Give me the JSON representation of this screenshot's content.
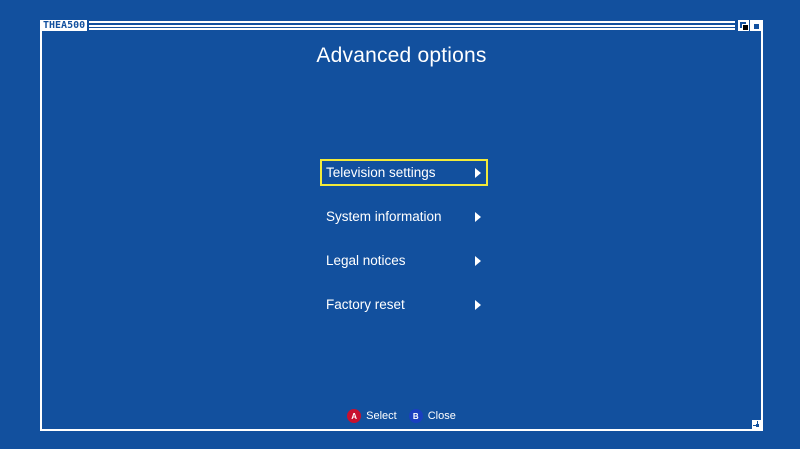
{
  "window": {
    "title": "THEA500"
  },
  "page": {
    "title": "Advanced options"
  },
  "menu": {
    "items": [
      {
        "label": "Television settings",
        "selected": true
      },
      {
        "label": "System information",
        "selected": false
      },
      {
        "label": "Legal notices",
        "selected": false
      },
      {
        "label": "Factory reset",
        "selected": false
      }
    ]
  },
  "footer": {
    "hints": [
      {
        "button": "A",
        "label": "Select",
        "color": "#c8102e"
      },
      {
        "button": "B",
        "label": "Close",
        "color": "#1a3fc0"
      }
    ]
  },
  "colors": {
    "background": "#12509e",
    "selection": "#f2ea3a",
    "text": "#ffffff"
  },
  "icons": {
    "arrow": "triangle-right-icon",
    "depth": "depth-gadget-icon",
    "zoom": "zoom-gadget-icon",
    "resize": "resize-gadget-icon"
  }
}
